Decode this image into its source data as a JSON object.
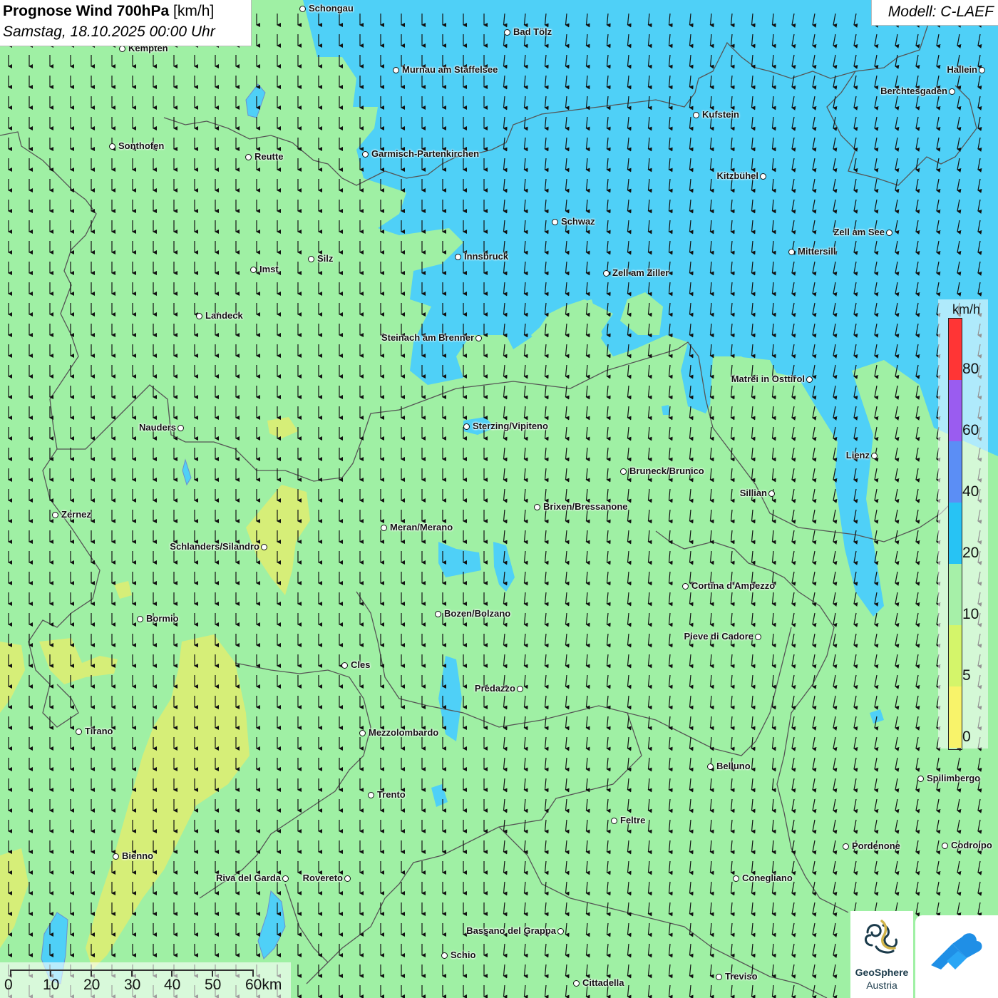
{
  "title": {
    "main": "Prognose Wind 700hPa",
    "unit": " [km/h]",
    "date": "Samstag, 18.10.2025 00:00 Uhr"
  },
  "model": "Modell: C-LAEF",
  "legend": {
    "unit": "km/h",
    "ticks": [
      "80",
      "60",
      "40",
      "20",
      "10",
      "5",
      "0"
    ],
    "colors": [
      "#ff3535",
      "#9a5cf0",
      "#5b8ef5",
      "#27c3f4",
      "#a6f0a8",
      "#d4f56a",
      "#f8f36a"
    ]
  },
  "scalebar": {
    "labels": [
      "0",
      "10",
      "20",
      "30",
      "40",
      "50",
      "60km"
    ]
  },
  "colors": {
    "calm_green": "#9ff0a4",
    "strong_blue": "#4fd0f7",
    "weak_yellow": "#d6ee78",
    "border_gray": "#555555"
  },
  "logos": {
    "geosphere_line1": "GeoSphere",
    "geosphere_line2": "Austria",
    "geosphere_icon": "geosphere-wave-icon",
    "app_icon": "mountain-cloud-icon"
  },
  "cities": [
    {
      "name": "Schongau",
      "anchor": "dot-left"
    },
    {
      "name": "Kempten",
      "anchor": "dot-left"
    },
    {
      "name": "Bad Tölz",
      "anchor": "dot-left"
    },
    {
      "name": "Murnau am Staffelsee",
      "anchor": "dot-left"
    },
    {
      "name": "Hallein",
      "anchor": "dot-right"
    },
    {
      "name": "Berchtesgaden",
      "anchor": "dot-right"
    },
    {
      "name": "Kufstein",
      "anchor": "dot-left"
    },
    {
      "name": "Sonthofen",
      "anchor": "dot-left"
    },
    {
      "name": "Reutte",
      "anchor": "dot-left"
    },
    {
      "name": "Garmisch-Partenkirchen",
      "anchor": "dot-left"
    },
    {
      "name": "Kitzbühel",
      "anchor": "dot-right"
    },
    {
      "name": "Schwaz",
      "anchor": "dot-left"
    },
    {
      "name": "Zell am See",
      "anchor": "dot-right"
    },
    {
      "name": "Innsbruck",
      "anchor": "dot-left"
    },
    {
      "name": "Silz",
      "anchor": "dot-left"
    },
    {
      "name": "Imst",
      "anchor": "dot-left"
    },
    {
      "name": "Mittersill",
      "anchor": "dot-left"
    },
    {
      "name": "Zell am Ziller",
      "anchor": "dot-left"
    },
    {
      "name": "Landeck",
      "anchor": "dot-left"
    },
    {
      "name": "Steinach am Brenner",
      "anchor": "dot-right"
    },
    {
      "name": "Matrei in Osttirol",
      "anchor": "dot-right"
    },
    {
      "name": "Nauders",
      "anchor": "dot-right"
    },
    {
      "name": "Sterzing/Vipiteno",
      "anchor": "dot-left"
    },
    {
      "name": "Lienz",
      "anchor": "dot-right"
    },
    {
      "name": "Bruneck/Brunico",
      "anchor": "dot-left"
    },
    {
      "name": "Sillian",
      "anchor": "dot-right"
    },
    {
      "name": "Zernez",
      "anchor": "dot-left"
    },
    {
      "name": "Brixen/Bressanone",
      "anchor": "dot-left"
    },
    {
      "name": "Meran/Merano",
      "anchor": "dot-left"
    },
    {
      "name": "Schlanders/Silandro",
      "anchor": "dot-right"
    },
    {
      "name": "Cortina d'Ampezzo",
      "anchor": "dot-left"
    },
    {
      "name": "Bozen/Bolzano",
      "anchor": "dot-left"
    },
    {
      "name": "Bormio",
      "anchor": "dot-left"
    },
    {
      "name": "Pieve di Cadore",
      "anchor": "dot-right"
    },
    {
      "name": "Cles",
      "anchor": "dot-left"
    },
    {
      "name": "Predazzo",
      "anchor": "dot-right"
    },
    {
      "name": "Tirano",
      "anchor": "dot-left"
    },
    {
      "name": "Mezzolombardo",
      "anchor": "dot-left"
    },
    {
      "name": "Belluno",
      "anchor": "dot-left"
    },
    {
      "name": "Spilimbergo",
      "anchor": "dot-left"
    },
    {
      "name": "Trento",
      "anchor": "dot-left"
    },
    {
      "name": "Feltre",
      "anchor": "dot-left"
    },
    {
      "name": "Pordenone",
      "anchor": "dot-left"
    },
    {
      "name": "Codroipo",
      "anchor": "dot-left"
    },
    {
      "name": "Bienno",
      "anchor": "dot-left"
    },
    {
      "name": "Riva del Garda",
      "anchor": "dot-right"
    },
    {
      "name": "Rovereto",
      "anchor": "dot-right"
    },
    {
      "name": "Conegliano",
      "anchor": "dot-left"
    },
    {
      "name": "Bassano del Grappa",
      "anchor": "dot-right"
    },
    {
      "name": "Schio",
      "anchor": "dot-left"
    },
    {
      "name": "Treviso",
      "anchor": "dot-left"
    },
    {
      "name": "Cittadella",
      "anchor": "dot-left"
    }
  ]
}
